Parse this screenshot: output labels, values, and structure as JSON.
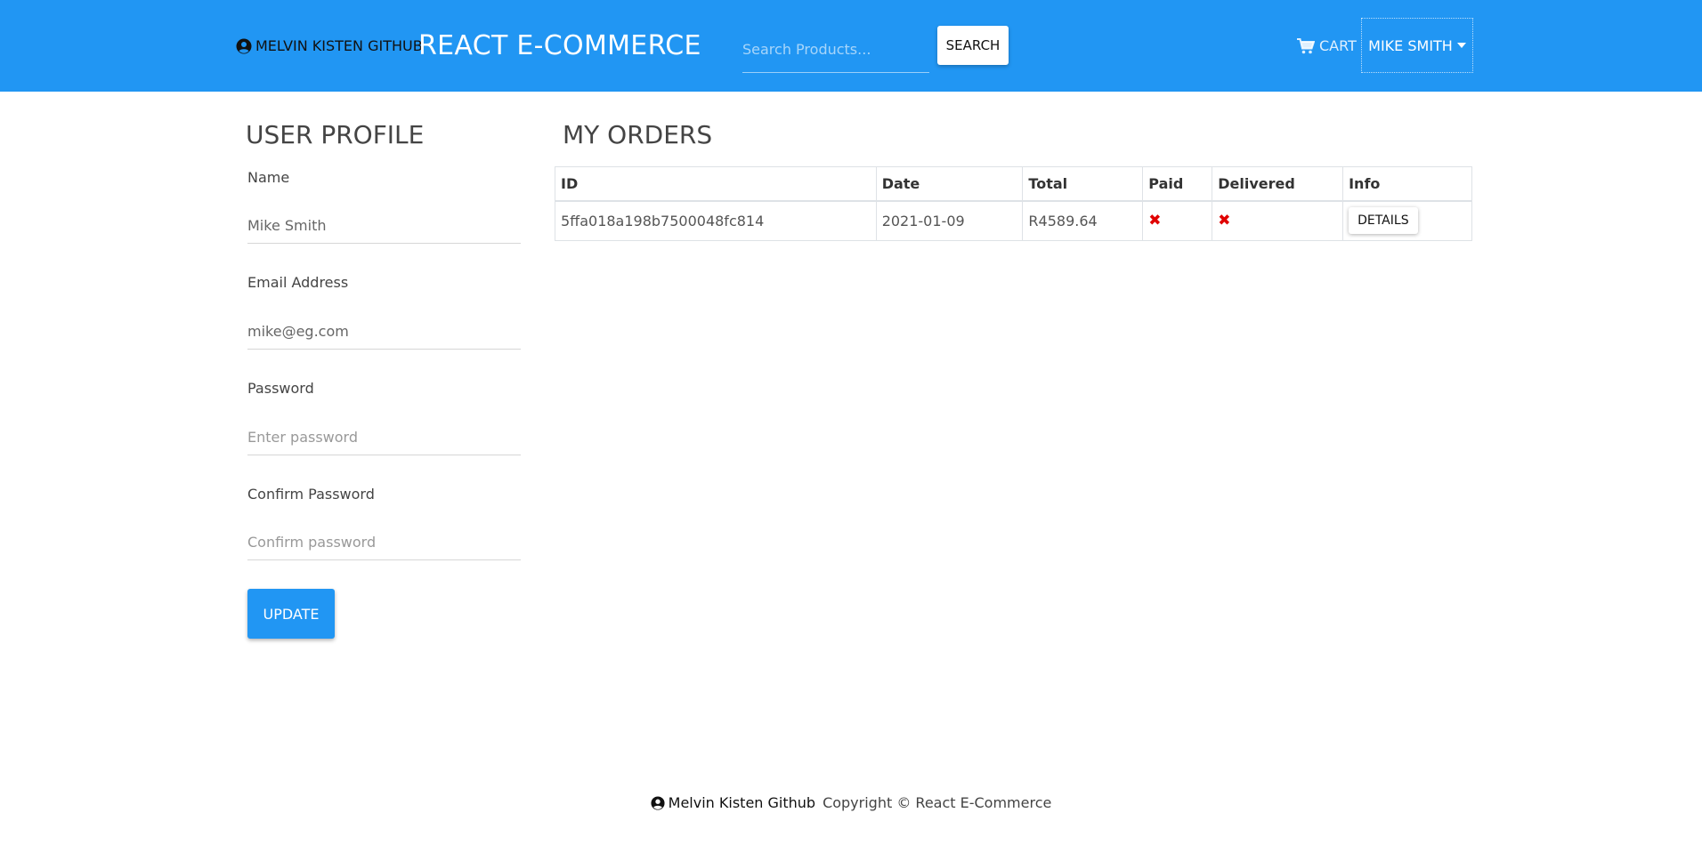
{
  "navbar": {
    "github_label": "MELVIN KISTEN GITHUB",
    "brand_title": "REACT E-COMMERCE",
    "search_placeholder": "Search Products...",
    "search_button": "SEARCH",
    "cart_label": "CART",
    "user_menu_label": "MIKE SMITH",
    "color": "#2196f3"
  },
  "profile": {
    "heading": "USER PROFILE",
    "name_label": "Name",
    "name_value": "Mike Smith",
    "email_label": "Email Address",
    "email_value": "mike@eg.com",
    "password_label": "Password",
    "password_placeholder": "Enter password",
    "confirm_label": "Confirm Password",
    "confirm_placeholder": "Confirm password",
    "update_button": "UPDATE"
  },
  "orders": {
    "heading": "MY ORDERS",
    "columns": [
      "ID",
      "Date",
      "Total",
      "Paid",
      "Delivered",
      "Info"
    ],
    "rows": [
      {
        "id": "5ffa018a198b7500048fc814",
        "date": "2021-01-09",
        "total": "R4589.64",
        "paid_icon": "✖",
        "delivered_icon": "✖",
        "info_button": "DETAILS"
      }
    ]
  },
  "footer": {
    "github_label": "Melvin Kisten Github",
    "copyright": "Copyright © React E-Commerce"
  }
}
